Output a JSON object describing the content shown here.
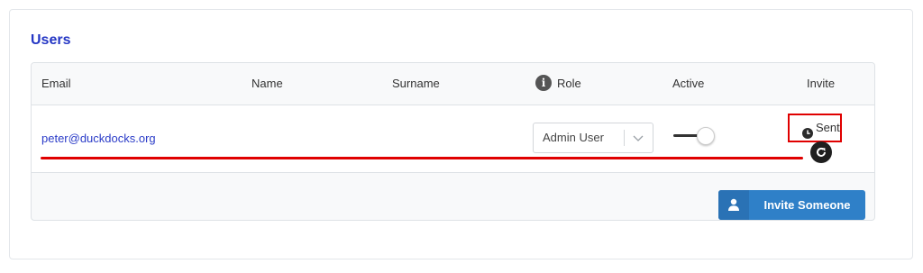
{
  "section_title": "Users",
  "table": {
    "headers": {
      "email": "Email",
      "name": "Name",
      "surname": "Surname",
      "role": "Role",
      "active": "Active",
      "invite": "Invite"
    },
    "role_info_icon": "info-icon",
    "rows": [
      {
        "email": "peter@duckdocks.org",
        "name": "",
        "surname": "",
        "role": "Admin User",
        "active": true,
        "invite_status": "Sent",
        "invite_status_icon": "clock-icon",
        "resend_icon": "refresh-icon"
      }
    ]
  },
  "invite_button": {
    "label": "Invite Someone",
    "icon": "user-icon"
  },
  "colors": {
    "title": "#2436c4",
    "link": "#2b3cc8",
    "highlight": "#e00000",
    "button": "#2f80c8"
  }
}
